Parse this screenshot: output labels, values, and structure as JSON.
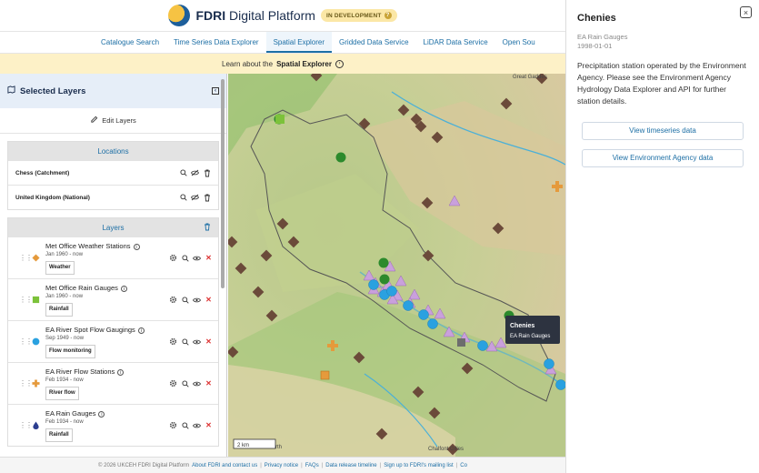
{
  "header": {
    "brand_bold": "FDRI",
    "brand_rest": " Digital Platform",
    "badge": "IN DEVELOPMENT"
  },
  "nav": {
    "tabs": [
      {
        "label": "Catalogue Search",
        "active": false
      },
      {
        "label": "Time Series Data Explorer",
        "active": false
      },
      {
        "label": "Spatial Explorer",
        "active": true
      },
      {
        "label": "Gridded Data Service",
        "active": false
      },
      {
        "label": "LiDAR Data Service",
        "active": false
      },
      {
        "label": "Open Sou",
        "active": false
      }
    ]
  },
  "banner": {
    "prefix": "Learn about the",
    "link": "Spatial Explorer"
  },
  "sidebar": {
    "title": "Selected Layers",
    "edit_label": "Edit Layers",
    "locations_title": "Locations",
    "locations": [
      {
        "label": "Chess (Catchment)"
      },
      {
        "label": "United Kingdom (National)"
      }
    ],
    "layers_title": "Layers",
    "layers": [
      {
        "name": "Met Office Weather Stations",
        "date": "Jan 1960 - now",
        "tag": "Weather",
        "symbol": "diamond",
        "color": "#e59a3c"
      },
      {
        "name": "Met Office Rain Gauges",
        "date": "Jan 1960 - now",
        "tag": "Rainfall",
        "symbol": "square",
        "color": "#7cc23a"
      },
      {
        "name": "EA River Spot Flow Gaugings",
        "date": "Sep 1949 - now",
        "tag": "Flow monitoring",
        "symbol": "circle",
        "color": "#2aa1e0"
      },
      {
        "name": "EA River Flow Stations",
        "date": "Feb 1934 - now",
        "tag": "River flow",
        "symbol": "cross",
        "color": "#e59a3c"
      },
      {
        "name": "EA Rain Gauges",
        "date": "Feb 1934 - now",
        "tag": "Rainfall",
        "symbol": "drop",
        "color": "#2c3e8f"
      }
    ]
  },
  "map": {
    "tooltip_title": "Chenies",
    "tooltip_sub": "EA Rain Gauges",
    "scale_label": "2 km",
    "place_top": "Great Gaddes",
    "place_bottom_left": "rth",
    "place_bottom_right": "Chalfont Gilles"
  },
  "panel": {
    "title": "Chenies",
    "subtitle": "EA Rain Gauges",
    "date": "1998-01-01",
    "description": "Precipitation station operated by the Environment Agency. Please see the Environment Agency Hydrology Data Explorer and API for further station details.",
    "btn_timeseries": "View timeseries data",
    "btn_ea": "View Environment Agency data"
  },
  "footer": {
    "copyright": "© 2026 UKCEH FDRI Digital Platform",
    "links": [
      "About FDRI and contact us",
      "Privacy notice",
      "FAQs",
      "Data release timeline",
      "Sign up to FDRI's mailing list",
      "Co"
    ]
  },
  "colors": {
    "accent": "#1d6fa5",
    "brown_marker": "#6b4a3a",
    "blue_marker": "#2aa1e0",
    "purple_marker": "#c9a0dc",
    "green_marker": "#2c8a2c"
  }
}
